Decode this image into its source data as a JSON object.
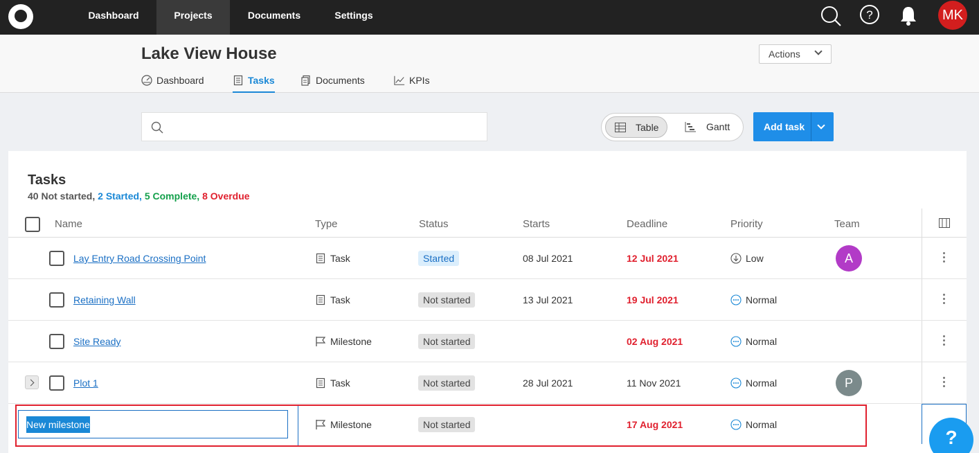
{
  "topnav": {
    "items": [
      {
        "label": "Dashboard",
        "active": false
      },
      {
        "label": "Projects",
        "active": true
      },
      {
        "label": "Documents",
        "active": false
      },
      {
        "label": "Settings",
        "active": false
      }
    ],
    "user_initials": "MK"
  },
  "project": {
    "title": "Lake View House",
    "actions_label": "Actions",
    "tabs": [
      {
        "label": "Dashboard",
        "icon": "dashboard-gauge-icon",
        "active": false
      },
      {
        "label": "Tasks",
        "icon": "tasks-clipboard-icon",
        "active": true
      },
      {
        "label": "Documents",
        "icon": "documents-icon",
        "active": false
      },
      {
        "label": "KPIs",
        "icon": "kpi-chart-icon",
        "active": false
      }
    ]
  },
  "toolbar": {
    "search_placeholder": "",
    "view_table": "Table",
    "view_gantt": "Gantt",
    "add_task": "Add task"
  },
  "tasks": {
    "title": "Tasks",
    "summary": {
      "not_started": "40 Not started,",
      "started": "2 Started,",
      "complete": "5 Complete,",
      "overdue": "8 Overdue"
    },
    "columns": [
      "Name",
      "Type",
      "Status",
      "Starts",
      "Deadline",
      "Priority",
      "Team"
    ],
    "rows": [
      {
        "name": "Lay Entry Road Crossing Point",
        "type": "Task",
        "status": "Started",
        "starts": "08 Jul 2021",
        "deadline": "12 Jul 2021",
        "overdue": true,
        "priority": "Low",
        "team": "A",
        "team_color": "#b23bc7"
      },
      {
        "name": "Retaining Wall",
        "type": "Task",
        "status": "Not started",
        "starts": "13 Jul 2021",
        "deadline": "19 Jul 2021",
        "overdue": true,
        "priority": "Normal",
        "team": ""
      },
      {
        "name": "Site Ready",
        "type": "Milestone",
        "status": "Not started",
        "starts": "",
        "deadline": "02 Aug 2021",
        "overdue": true,
        "priority": "Normal",
        "team": ""
      },
      {
        "name": "Plot 1",
        "type": "Task",
        "status": "Not started",
        "starts": "28 Jul 2021",
        "deadline": "11 Nov 2021",
        "overdue": false,
        "priority": "Normal",
        "team": "P",
        "team_color": "#7b8a8b"
      }
    ],
    "new_row": {
      "name": "New milestone",
      "type": "Milestone",
      "status": "Not started",
      "starts": "",
      "deadline": "17 Aug 2021",
      "priority": "Normal"
    }
  },
  "help_label": "?",
  "colors": {
    "accent": "#1a88d6",
    "overdue": "#e0202e",
    "complete": "#13a04b",
    "topbar": "#222222"
  }
}
